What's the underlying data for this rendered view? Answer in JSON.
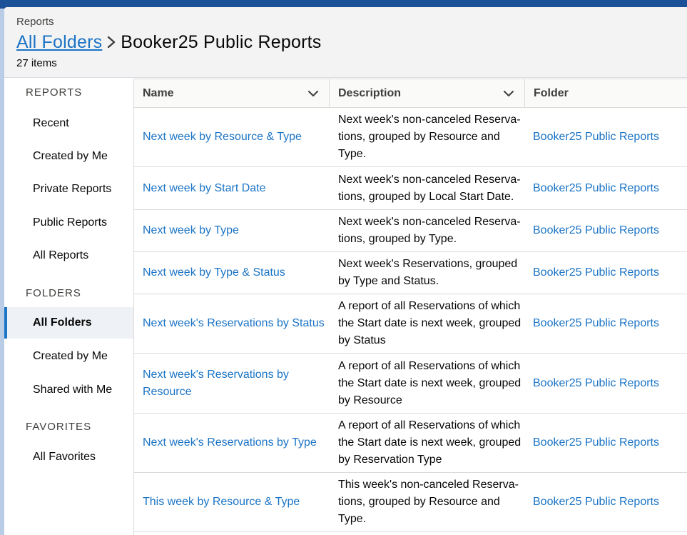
{
  "header": {
    "eyebrow": "Reports",
    "breadcrumb_link": "All Folders",
    "current_folder": "Booker25 Public Reports",
    "item_count": "27 items"
  },
  "sidebar": {
    "reports_heading": "REPORTS",
    "reports_items": [
      "Recent",
      "Created by Me",
      "Private Reports",
      "Public Reports",
      "All Reports"
    ],
    "folders_heading": "FOLDERS",
    "folders_items": [
      "All Folders",
      "Created by Me",
      "Shared with Me"
    ],
    "active_item": "All Folders",
    "favorites_heading": "FAVORITES",
    "favorites_items": [
      "All Favorites"
    ]
  },
  "table": {
    "columns": {
      "name": "Name",
      "description": "Description",
      "folder": "Folder"
    },
    "rows": [
      {
        "name": "Next week by Resource & Type",
        "description": "Next week's non-canceled Reserva-tions, grouped by Resource and Type.",
        "folder": "Booker25 Public Reports"
      },
      {
        "name": "Next week by Start Date",
        "description": "Next week's non-canceled Reserva-tions, grouped by Local Start Date.",
        "folder": "Booker25 Public Reports"
      },
      {
        "name": "Next week by Type",
        "description": "Next week's non-canceled Reserva-tions, grouped by Type.",
        "folder": "Booker25 Public Reports"
      },
      {
        "name": "Next week by Type & Status",
        "description": "Next week's Reservations, grouped by Type and Status.",
        "folder": "Booker25 Public Reports"
      },
      {
        "name": "Next week's Reservations by Status",
        "description": "A report of all Reservations of which the Start date is next week, grouped by Status",
        "folder": "Booker25 Public Reports"
      },
      {
        "name": "Next week's Reservations by Resource",
        "description": "A report of all Reservations of which the Start date is next week, grouped by Resource",
        "folder": "Booker25 Public Reports"
      },
      {
        "name": "Next week's Reservations by Type",
        "description": "A report of all Reservations of which the Start date is next week, grouped by Reservation Type",
        "folder": "Booker25 Public Reports"
      },
      {
        "name": "This week by Resource & Type",
        "description": "This week's non-canceled Reserva-tions, grouped by Resource and Type.",
        "folder": "Booker25 Public Reports"
      }
    ]
  },
  "colors": {
    "link": "#1b74c5",
    "active_accent": "#1b74c5",
    "header_bg": "#f3f3f3",
    "top_band": "#1b5297"
  }
}
